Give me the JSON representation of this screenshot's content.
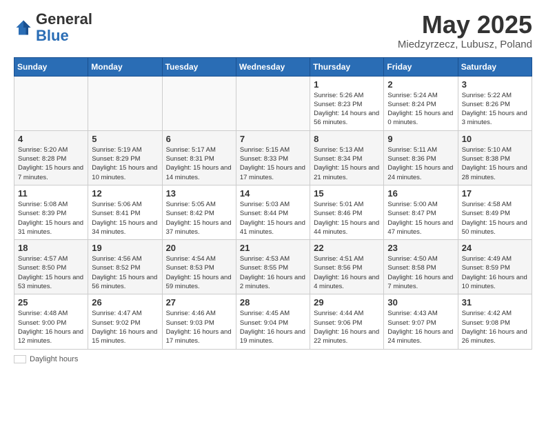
{
  "header": {
    "logo_general": "General",
    "logo_blue": "Blue",
    "month_title": "May 2025",
    "subtitle": "Miedzyrzecz, Lubusz, Poland"
  },
  "days_of_week": [
    "Sunday",
    "Monday",
    "Tuesday",
    "Wednesday",
    "Thursday",
    "Friday",
    "Saturday"
  ],
  "weeks": [
    [
      {
        "num": "",
        "info": ""
      },
      {
        "num": "",
        "info": ""
      },
      {
        "num": "",
        "info": ""
      },
      {
        "num": "",
        "info": ""
      },
      {
        "num": "1",
        "info": "Sunrise: 5:26 AM\nSunset: 8:23 PM\nDaylight: 14 hours and 56 minutes."
      },
      {
        "num": "2",
        "info": "Sunrise: 5:24 AM\nSunset: 8:24 PM\nDaylight: 15 hours and 0 minutes."
      },
      {
        "num": "3",
        "info": "Sunrise: 5:22 AM\nSunset: 8:26 PM\nDaylight: 15 hours and 3 minutes."
      }
    ],
    [
      {
        "num": "4",
        "info": "Sunrise: 5:20 AM\nSunset: 8:28 PM\nDaylight: 15 hours and 7 minutes."
      },
      {
        "num": "5",
        "info": "Sunrise: 5:19 AM\nSunset: 8:29 PM\nDaylight: 15 hours and 10 minutes."
      },
      {
        "num": "6",
        "info": "Sunrise: 5:17 AM\nSunset: 8:31 PM\nDaylight: 15 hours and 14 minutes."
      },
      {
        "num": "7",
        "info": "Sunrise: 5:15 AM\nSunset: 8:33 PM\nDaylight: 15 hours and 17 minutes."
      },
      {
        "num": "8",
        "info": "Sunrise: 5:13 AM\nSunset: 8:34 PM\nDaylight: 15 hours and 21 minutes."
      },
      {
        "num": "9",
        "info": "Sunrise: 5:11 AM\nSunset: 8:36 PM\nDaylight: 15 hours and 24 minutes."
      },
      {
        "num": "10",
        "info": "Sunrise: 5:10 AM\nSunset: 8:38 PM\nDaylight: 15 hours and 28 minutes."
      }
    ],
    [
      {
        "num": "11",
        "info": "Sunrise: 5:08 AM\nSunset: 8:39 PM\nDaylight: 15 hours and 31 minutes."
      },
      {
        "num": "12",
        "info": "Sunrise: 5:06 AM\nSunset: 8:41 PM\nDaylight: 15 hours and 34 minutes."
      },
      {
        "num": "13",
        "info": "Sunrise: 5:05 AM\nSunset: 8:42 PM\nDaylight: 15 hours and 37 minutes."
      },
      {
        "num": "14",
        "info": "Sunrise: 5:03 AM\nSunset: 8:44 PM\nDaylight: 15 hours and 41 minutes."
      },
      {
        "num": "15",
        "info": "Sunrise: 5:01 AM\nSunset: 8:46 PM\nDaylight: 15 hours and 44 minutes."
      },
      {
        "num": "16",
        "info": "Sunrise: 5:00 AM\nSunset: 8:47 PM\nDaylight: 15 hours and 47 minutes."
      },
      {
        "num": "17",
        "info": "Sunrise: 4:58 AM\nSunset: 8:49 PM\nDaylight: 15 hours and 50 minutes."
      }
    ],
    [
      {
        "num": "18",
        "info": "Sunrise: 4:57 AM\nSunset: 8:50 PM\nDaylight: 15 hours and 53 minutes."
      },
      {
        "num": "19",
        "info": "Sunrise: 4:56 AM\nSunset: 8:52 PM\nDaylight: 15 hours and 56 minutes."
      },
      {
        "num": "20",
        "info": "Sunrise: 4:54 AM\nSunset: 8:53 PM\nDaylight: 15 hours and 59 minutes."
      },
      {
        "num": "21",
        "info": "Sunrise: 4:53 AM\nSunset: 8:55 PM\nDaylight: 16 hours and 2 minutes."
      },
      {
        "num": "22",
        "info": "Sunrise: 4:51 AM\nSunset: 8:56 PM\nDaylight: 16 hours and 4 minutes."
      },
      {
        "num": "23",
        "info": "Sunrise: 4:50 AM\nSunset: 8:58 PM\nDaylight: 16 hours and 7 minutes."
      },
      {
        "num": "24",
        "info": "Sunrise: 4:49 AM\nSunset: 8:59 PM\nDaylight: 16 hours and 10 minutes."
      }
    ],
    [
      {
        "num": "25",
        "info": "Sunrise: 4:48 AM\nSunset: 9:00 PM\nDaylight: 16 hours and 12 minutes."
      },
      {
        "num": "26",
        "info": "Sunrise: 4:47 AM\nSunset: 9:02 PM\nDaylight: 16 hours and 15 minutes."
      },
      {
        "num": "27",
        "info": "Sunrise: 4:46 AM\nSunset: 9:03 PM\nDaylight: 16 hours and 17 minutes."
      },
      {
        "num": "28",
        "info": "Sunrise: 4:45 AM\nSunset: 9:04 PM\nDaylight: 16 hours and 19 minutes."
      },
      {
        "num": "29",
        "info": "Sunrise: 4:44 AM\nSunset: 9:06 PM\nDaylight: 16 hours and 22 minutes."
      },
      {
        "num": "30",
        "info": "Sunrise: 4:43 AM\nSunset: 9:07 PM\nDaylight: 16 hours and 24 minutes."
      },
      {
        "num": "31",
        "info": "Sunrise: 4:42 AM\nSunset: 9:08 PM\nDaylight: 16 hours and 26 minutes."
      }
    ]
  ],
  "legend": {
    "label": "Daylight hours"
  }
}
